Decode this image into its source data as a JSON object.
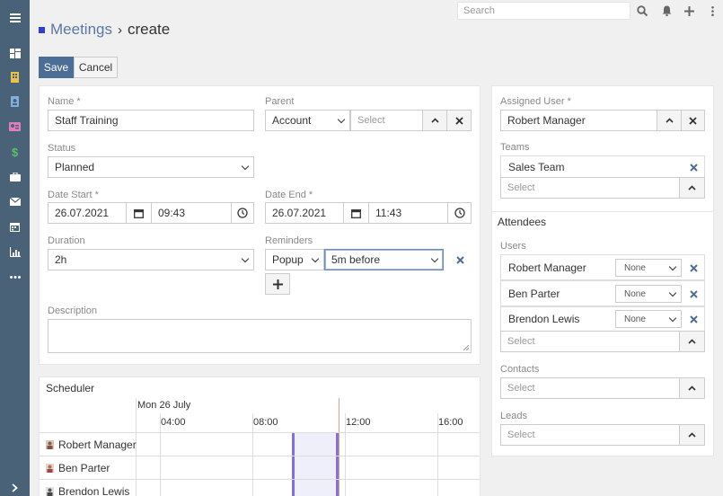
{
  "sidebar": {
    "icons": [
      "menu-icon",
      "dashboard-icon",
      "building-icon",
      "contact-card-icon",
      "id-card-icon",
      "dollar-icon",
      "briefcase-icon",
      "envelope-icon",
      "calendar-icon",
      "chart-icon",
      "more-icon",
      "chevron-right-icon"
    ]
  },
  "topbar": {
    "search_placeholder": "Search"
  },
  "header": {
    "crumb": "Meetings",
    "sep": "›",
    "current": "create"
  },
  "actions": {
    "save": "Save",
    "cancel": "Cancel"
  },
  "form": {
    "name_label": "Name *",
    "name_value": "Staff Training",
    "parent_label": "Parent",
    "parent_type": "Account",
    "parent_placeholder": "Select",
    "status_label": "Status",
    "status_value": "Planned",
    "date_start_label": "Date Start *",
    "date_start_date": "26.07.2021",
    "date_start_time": "09:43",
    "date_end_label": "Date End *",
    "date_end_date": "26.07.2021",
    "date_end_time": "11:43",
    "duration_label": "Duration",
    "duration_value": "2h",
    "reminders_label": "Reminders",
    "reminder_type": "Popup",
    "reminder_time": "5m before",
    "description_label": "Description"
  },
  "side": {
    "assigned_label": "Assigned User *",
    "assigned_value": "Robert Manager",
    "teams_label": "Teams",
    "team_item": "Sales Team",
    "teams_placeholder": "Select",
    "attendees_title": "Attendees",
    "users_label": "Users",
    "users": [
      {
        "name": "Robert Manager",
        "status": "None"
      },
      {
        "name": "Ben Parter",
        "status": "None"
      },
      {
        "name": "Brendon Lewis",
        "status": "None"
      }
    ],
    "users_placeholder": "Select",
    "contacts_label": "Contacts",
    "contacts_placeholder": "Select",
    "leads_label": "Leads",
    "leads_placeholder": "Select"
  },
  "scheduler": {
    "title": "Scheduler",
    "day": "Mon 26 July",
    "times": [
      "04:00",
      "08:00",
      "12:00",
      "16:00"
    ],
    "rows": [
      "Robert Manager",
      "Ben Parter",
      "Brendon Lewis"
    ]
  }
}
